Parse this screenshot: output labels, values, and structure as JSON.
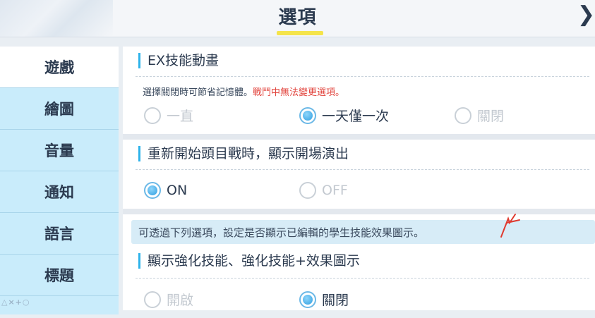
{
  "header": {
    "title": "選項",
    "close_icon": "chevron-right-icon"
  },
  "sidebar": {
    "items": [
      {
        "label": "遊戲",
        "active": true
      },
      {
        "label": "繪圖",
        "active": false
      },
      {
        "label": "音量",
        "active": false
      },
      {
        "label": "通知",
        "active": false
      },
      {
        "label": "語言",
        "active": false
      },
      {
        "label": "標題",
        "active": false
      }
    ],
    "footer_glyphs": "△×+○"
  },
  "sections": {
    "ex_skill": {
      "heading": "EX技能動畫",
      "note": "選擇關閉時可節省記憶體。",
      "note_warning": "戰鬥中無法變更選項。",
      "options": [
        "一直",
        "一天僅一次",
        "關閉"
      ],
      "selected": "一天僅一次"
    },
    "restart": {
      "heading": "重新開始頭目戰時，顯示開場演出",
      "options": [
        "ON",
        "OFF"
      ],
      "selected": "ON"
    },
    "info_text": "可透過下列選項，設定是否顯示已編輯的學生技能效果圖示。",
    "skill_icons": {
      "heading": "顯示強化技能、強化技能+效果圖示",
      "options": [
        "開啟",
        "關閉"
      ],
      "selected": "關閉"
    }
  },
  "colors": {
    "accent": "#2eb3ea",
    "tab_bg": "#c9ecfb",
    "warning": "#e2463f",
    "underline": "#f5e44a"
  }
}
